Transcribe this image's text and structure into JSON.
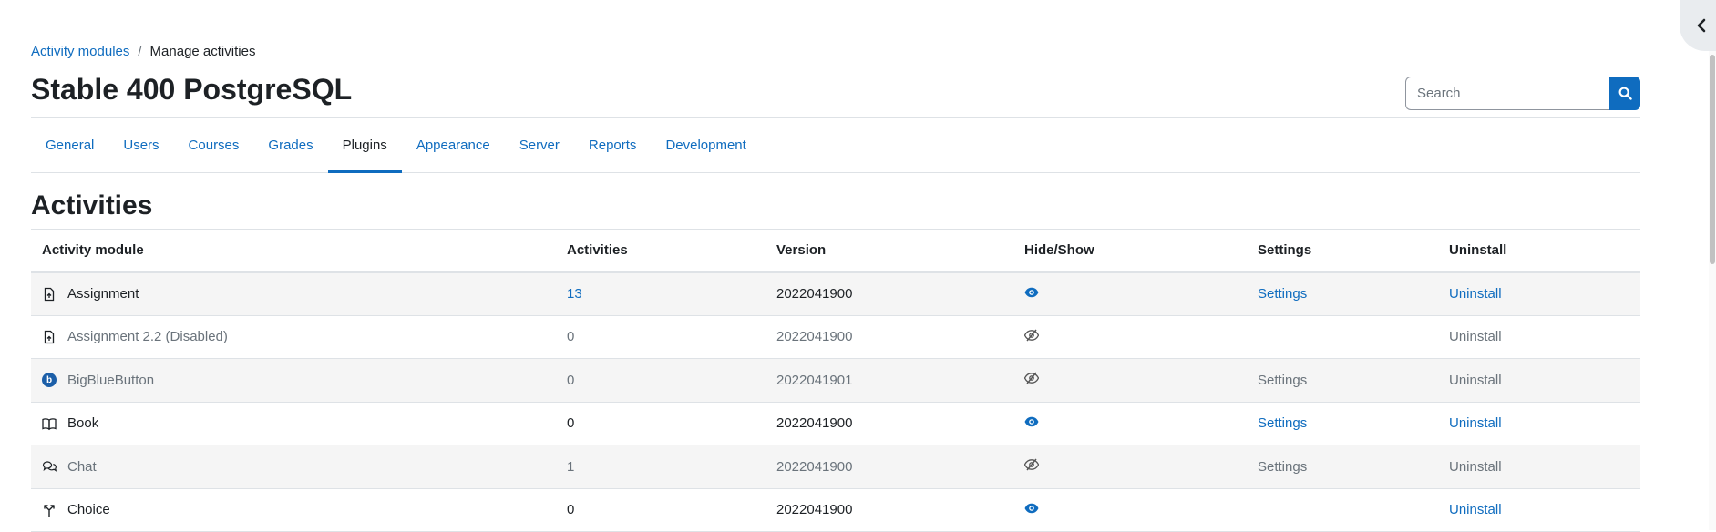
{
  "breadcrumb": {
    "items": [
      {
        "label": "Activity modules"
      },
      {
        "label": "Manage activities"
      }
    ],
    "separator": "/"
  },
  "header": {
    "title": "Stable 400 PostgreSQL",
    "search": {
      "placeholder": "Search",
      "value": ""
    }
  },
  "tabs": [
    {
      "label": "General"
    },
    {
      "label": "Users"
    },
    {
      "label": "Courses"
    },
    {
      "label": "Grades"
    },
    {
      "label": "Plugins",
      "active": true
    },
    {
      "label": "Appearance"
    },
    {
      "label": "Server"
    },
    {
      "label": "Reports"
    },
    {
      "label": "Development"
    }
  ],
  "section": {
    "title": "Activities"
  },
  "table": {
    "headers": {
      "module": "Activity module",
      "activities": "Activities",
      "version": "Version",
      "hideshow": "Hide/Show",
      "settings": "Settings",
      "uninstall": "Uninstall"
    },
    "rows": [
      {
        "name": "Assignment",
        "icon": "assignment-icon",
        "activities": "13",
        "version": "2022041900",
        "visible": true,
        "settings": "Settings",
        "uninstall": "Uninstall",
        "dimmed": false
      },
      {
        "name": "Assignment 2.2 (Disabled)",
        "icon": "assignment-icon",
        "activities": "0",
        "version": "2022041900",
        "visible": false,
        "settings": "",
        "uninstall": "Uninstall",
        "dimmed": true
      },
      {
        "name": "BigBlueButton",
        "icon": "bigbluebutton-icon",
        "activities": "0",
        "version": "2022041901",
        "visible": false,
        "settings": "Settings",
        "uninstall": "Uninstall",
        "dimmed": true
      },
      {
        "name": "Book",
        "icon": "book-icon",
        "activities": "0",
        "version": "2022041900",
        "visible": true,
        "settings": "Settings",
        "uninstall": "Uninstall",
        "dimmed": false
      },
      {
        "name": "Chat",
        "icon": "chat-icon",
        "activities": "1",
        "version": "2022041900",
        "visible": false,
        "settings": "Settings",
        "uninstall": "Uninstall",
        "dimmed": true
      },
      {
        "name": "Choice",
        "icon": "choice-icon",
        "activities": "0",
        "version": "2022041900",
        "visible": true,
        "settings": "",
        "uninstall": "Uninstall",
        "dimmed": false
      }
    ]
  },
  "colors": {
    "link": "#0f6cbf",
    "text": "#1d2125",
    "muted": "#6a737b",
    "stripe": "#f5f5f5",
    "border": "#dee2e6"
  },
  "drawer": {
    "icon": "chevron-left-icon"
  }
}
